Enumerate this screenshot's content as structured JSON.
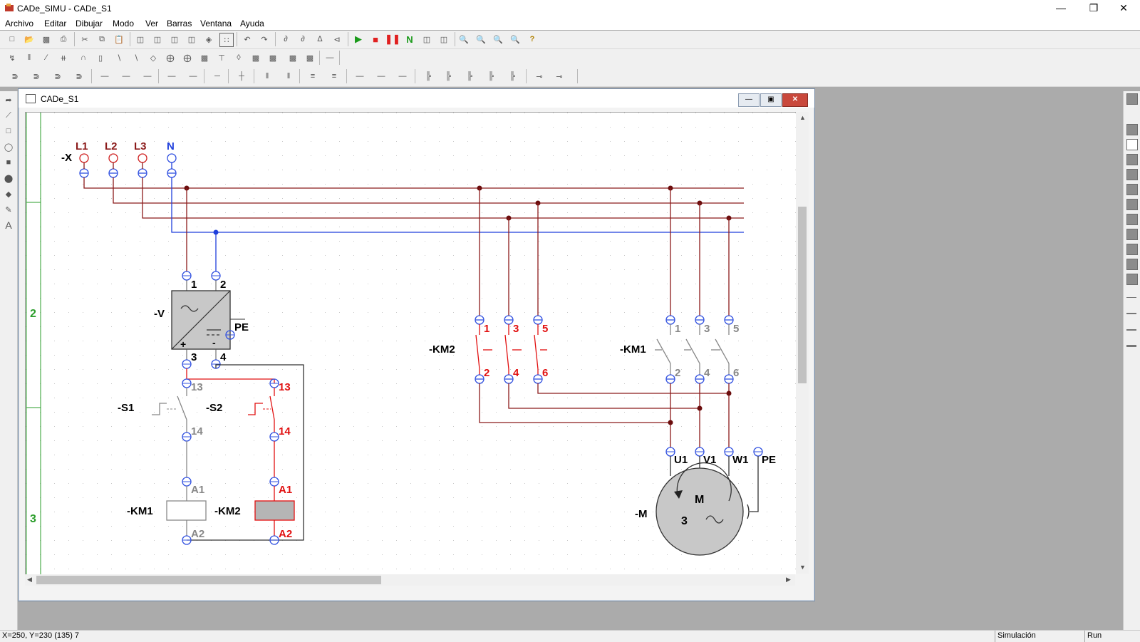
{
  "app": {
    "title": "CADe_SIMU - CADe_S1"
  },
  "menu": [
    "Archivo",
    "Editar",
    "Dibujar",
    "Modo",
    "Ver",
    "Barras",
    "Ventana",
    "Ayuda"
  ],
  "window": {
    "title": "CADe_S1"
  },
  "schematic": {
    "row_numbers": [
      "2",
      "3"
    ],
    "terminal_block": {
      "ref": "-X",
      "terminals": [
        "L1",
        "L2",
        "L3",
        "N"
      ]
    },
    "power_supply": {
      "ref": "-V",
      "pins": [
        "1",
        "2",
        "3",
        "4"
      ],
      "pe": "PE",
      "plus": "+",
      "minus": "-"
    },
    "s1": {
      "ref": "-S1",
      "top": "13",
      "bottom": "14"
    },
    "s2": {
      "ref": "-S2",
      "top": "13",
      "bottom": "14"
    },
    "coil_km1": {
      "ref": "-KM1",
      "a1": "A1",
      "a2": "A2"
    },
    "coil_km2": {
      "ref": "-KM2",
      "a1": "A1",
      "a2": "A2"
    },
    "contactor_km2": {
      "ref": "-KM2",
      "top": [
        "1",
        "3",
        "5"
      ],
      "bottom": [
        "2",
        "4",
        "6"
      ]
    },
    "contactor_km1": {
      "ref": "-KM1",
      "top": [
        "1",
        "3",
        "5"
      ],
      "bottom": [
        "2",
        "4",
        "6"
      ]
    },
    "motor": {
      "ref": "-M",
      "terminals": [
        "U1",
        "V1",
        "W1",
        "PE"
      ],
      "letter": "M",
      "phases": "3"
    }
  },
  "status": {
    "coords": "X=250, Y=230 (135) 7",
    "mode": "Simulación",
    "state": "Run"
  },
  "colors": {
    "phase": "#8b1a1a",
    "neutral": "#1f3fdc",
    "active": "#e11010",
    "inactive": "#888888",
    "gridline": "#2a9d2a"
  }
}
